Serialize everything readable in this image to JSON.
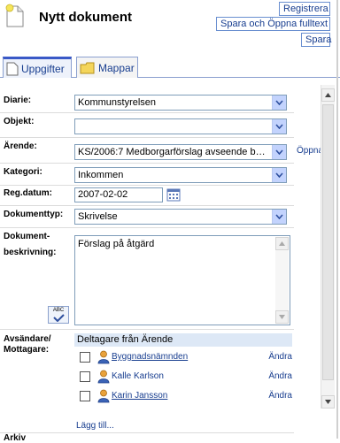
{
  "header": {
    "title": "Nytt dokument"
  },
  "toolbar": {
    "registrera": "Registrera",
    "spara_oppna": "Spara och Öppna fulltext",
    "spara": "Spara"
  },
  "tabs": [
    {
      "label": "Uppgifter",
      "active": true
    },
    {
      "label": "Mappar",
      "active": false
    }
  ],
  "form": {
    "diarie": {
      "label": "Diarie:",
      "value": "Kommunstyrelsen"
    },
    "objekt": {
      "label": "Objekt:",
      "value": ""
    },
    "arende": {
      "label": "Ärende:",
      "value": "KS/2006:7 Medborgarförslag avseende bull..",
      "link": "Öppna"
    },
    "kategori": {
      "label": "Kategori:",
      "value": "Inkommen"
    },
    "regdatum": {
      "label": "Reg.datum:",
      "value": "2007-02-02"
    },
    "dokumenttyp": {
      "label": "Dokumenttyp:",
      "value": "Skrivelse"
    },
    "beskrivning": {
      "label_line1": "Dokument-",
      "label_line2": "beskrivning:",
      "value": "Förslag på åtgärd"
    },
    "spell_label": "ABC",
    "avsandare": {
      "label_line1": "Avsändare/",
      "label_line2": "Mottagare:",
      "header": "Deltagare från Ärende",
      "rows": [
        {
          "name": "Byggnadsnämnden",
          "action": "Ändra"
        },
        {
          "name": "Kalle Karlson",
          "action": "Ändra"
        },
        {
          "name": "Karin Jansson",
          "action": "Ändra"
        }
      ],
      "add_link": "Lägg till..."
    },
    "cut_label": "Arkiv"
  },
  "colors": {
    "accent": "#173d8f",
    "tab_active_top": "#3a59c7",
    "dropdown": "#c3d3fd"
  },
  "icons": [
    "document-icon",
    "folder-icon",
    "calendar-icon",
    "person-icon",
    "spellcheck-icon",
    "chevron-down-icon"
  ]
}
